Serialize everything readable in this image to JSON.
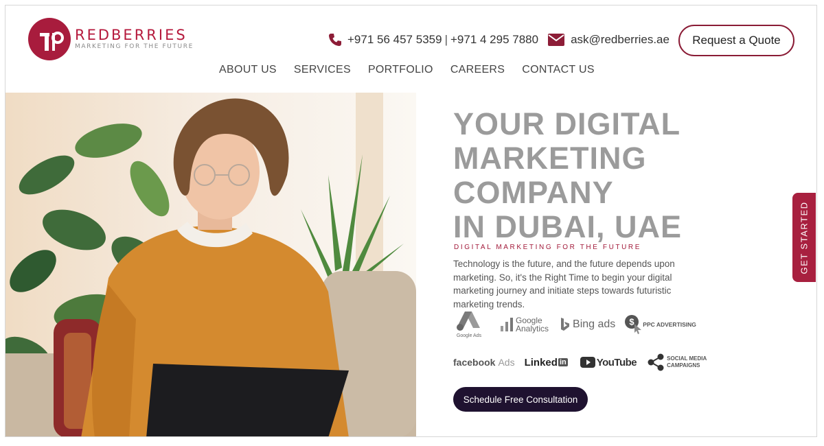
{
  "brand": {
    "name": "REDBERRIES",
    "tagline": "MARKETING FOR THE FUTURE",
    "logo_color": "#a81c3d"
  },
  "contact": {
    "phone1": "+971 56 457 5359",
    "separator": "|",
    "phone2": "+971 4 295 7880",
    "email": "ask@redberries.ae",
    "phone_icon": "phone-icon",
    "mail_icon": "envelope-icon"
  },
  "header": {
    "quote_button": "Request a Quote"
  },
  "nav": {
    "items": [
      {
        "label": "ABOUT US"
      },
      {
        "label": "SERVICES"
      },
      {
        "label": "PORTFOLIO"
      },
      {
        "label": "CAREERS"
      },
      {
        "label": "CONTACT US"
      }
    ]
  },
  "hero": {
    "headline_lines": [
      "YOUR DIGITAL",
      "MARKETING",
      "COMPANY",
      "IN DUBAI, UAE"
    ],
    "subheading": "DIGITAL MARKETING FOR THE FUTURE",
    "description": "Technology is the future, and the future depends upon marketing. So, it's the Right Time to begin your digital marketing journey and initiate steps towards futuristic marketing trends.",
    "cta": "Schedule Free Consultation",
    "accent_color": "#a21a3a",
    "cta_color": "#1f1230"
  },
  "service_logos": {
    "google_ads": "Google Ads",
    "google_analytics_1": "Google",
    "google_analytics_2": "Analytics",
    "bing_ads": "Bing ads",
    "ppc": "PPC ADVERTISING",
    "facebook": "facebook",
    "facebook_ads": "Ads",
    "linkedin": "Linked",
    "linkedin_in": "in",
    "youtube": "YouTube",
    "social_1": "SOCIAL MEDIA",
    "social_2": "CAMPAIGNS"
  },
  "side_tab": {
    "label": "GET STARTED",
    "color": "#a8203f"
  }
}
